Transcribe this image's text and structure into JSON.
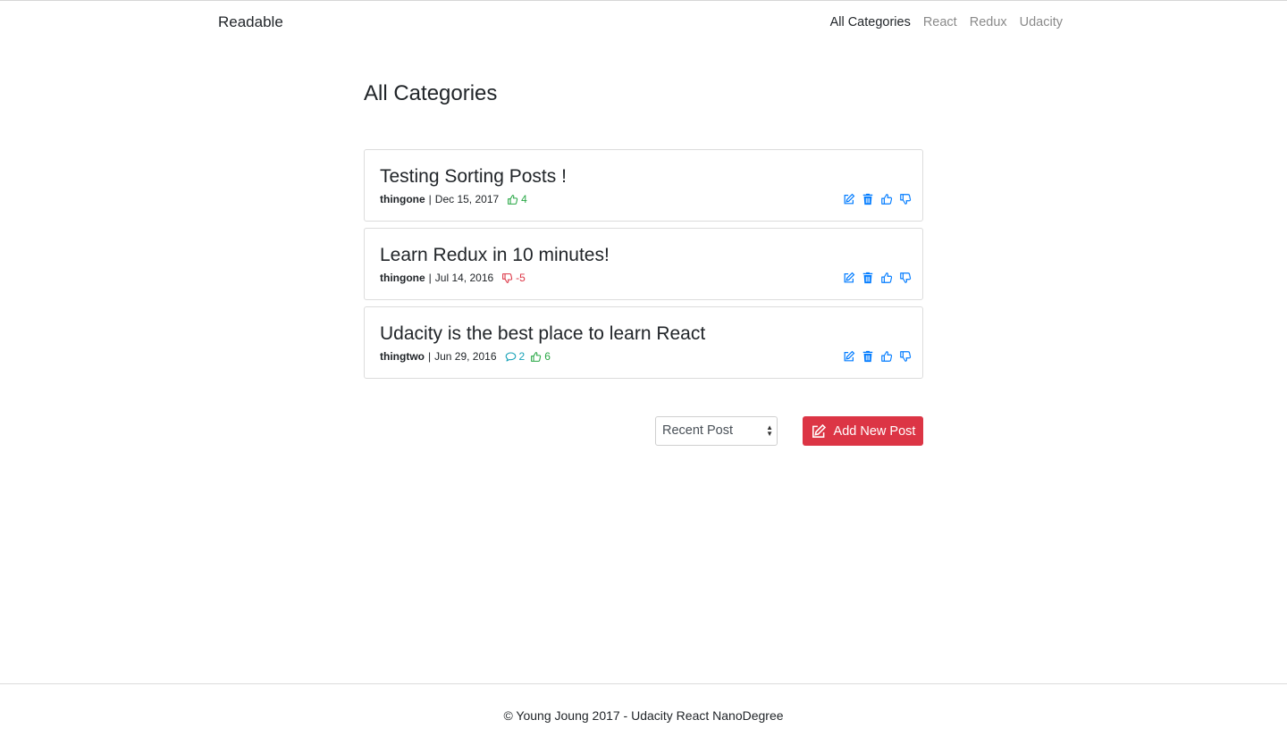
{
  "navbar": {
    "brand": "Readable",
    "links": [
      {
        "label": "All Categories",
        "active": true
      },
      {
        "label": "React",
        "active": false
      },
      {
        "label": "Redux",
        "active": false
      },
      {
        "label": "Udacity",
        "active": false
      }
    ]
  },
  "main": {
    "title": "All Categories",
    "posts": [
      {
        "title": "Testing Sorting Posts !",
        "author": "thingone",
        "separator": "|",
        "date": "Dec 15, 2017",
        "comments": null,
        "score": "4",
        "score_type": "up"
      },
      {
        "title": "Learn Redux in 10 minutes!",
        "author": "thingone",
        "separator": "|",
        "date": "Jul 14, 2016",
        "comments": null,
        "score": "-5",
        "score_type": "down"
      },
      {
        "title": "Udacity is the best place to learn React",
        "author": "thingtwo",
        "separator": "|",
        "date": "Jun 29, 2016",
        "comments": "2",
        "score": "6",
        "score_type": "up"
      }
    ],
    "actions": {
      "edit_icon": "edit-icon",
      "delete_icon": "trash-icon",
      "upvote_icon": "thumbs-up-icon",
      "downvote_icon": "thumbs-down-icon"
    },
    "sort_select": {
      "selected": "Recent Post"
    },
    "add_button": {
      "label": "Add New Post",
      "icon": "edit-icon"
    }
  },
  "footer": {
    "text": "© Young Joung 2017 - Udacity React NanoDegree"
  },
  "colors": {
    "accent": "#007bff",
    "danger": "#dc3545",
    "success": "#28a745",
    "info": "#17a2b8"
  }
}
